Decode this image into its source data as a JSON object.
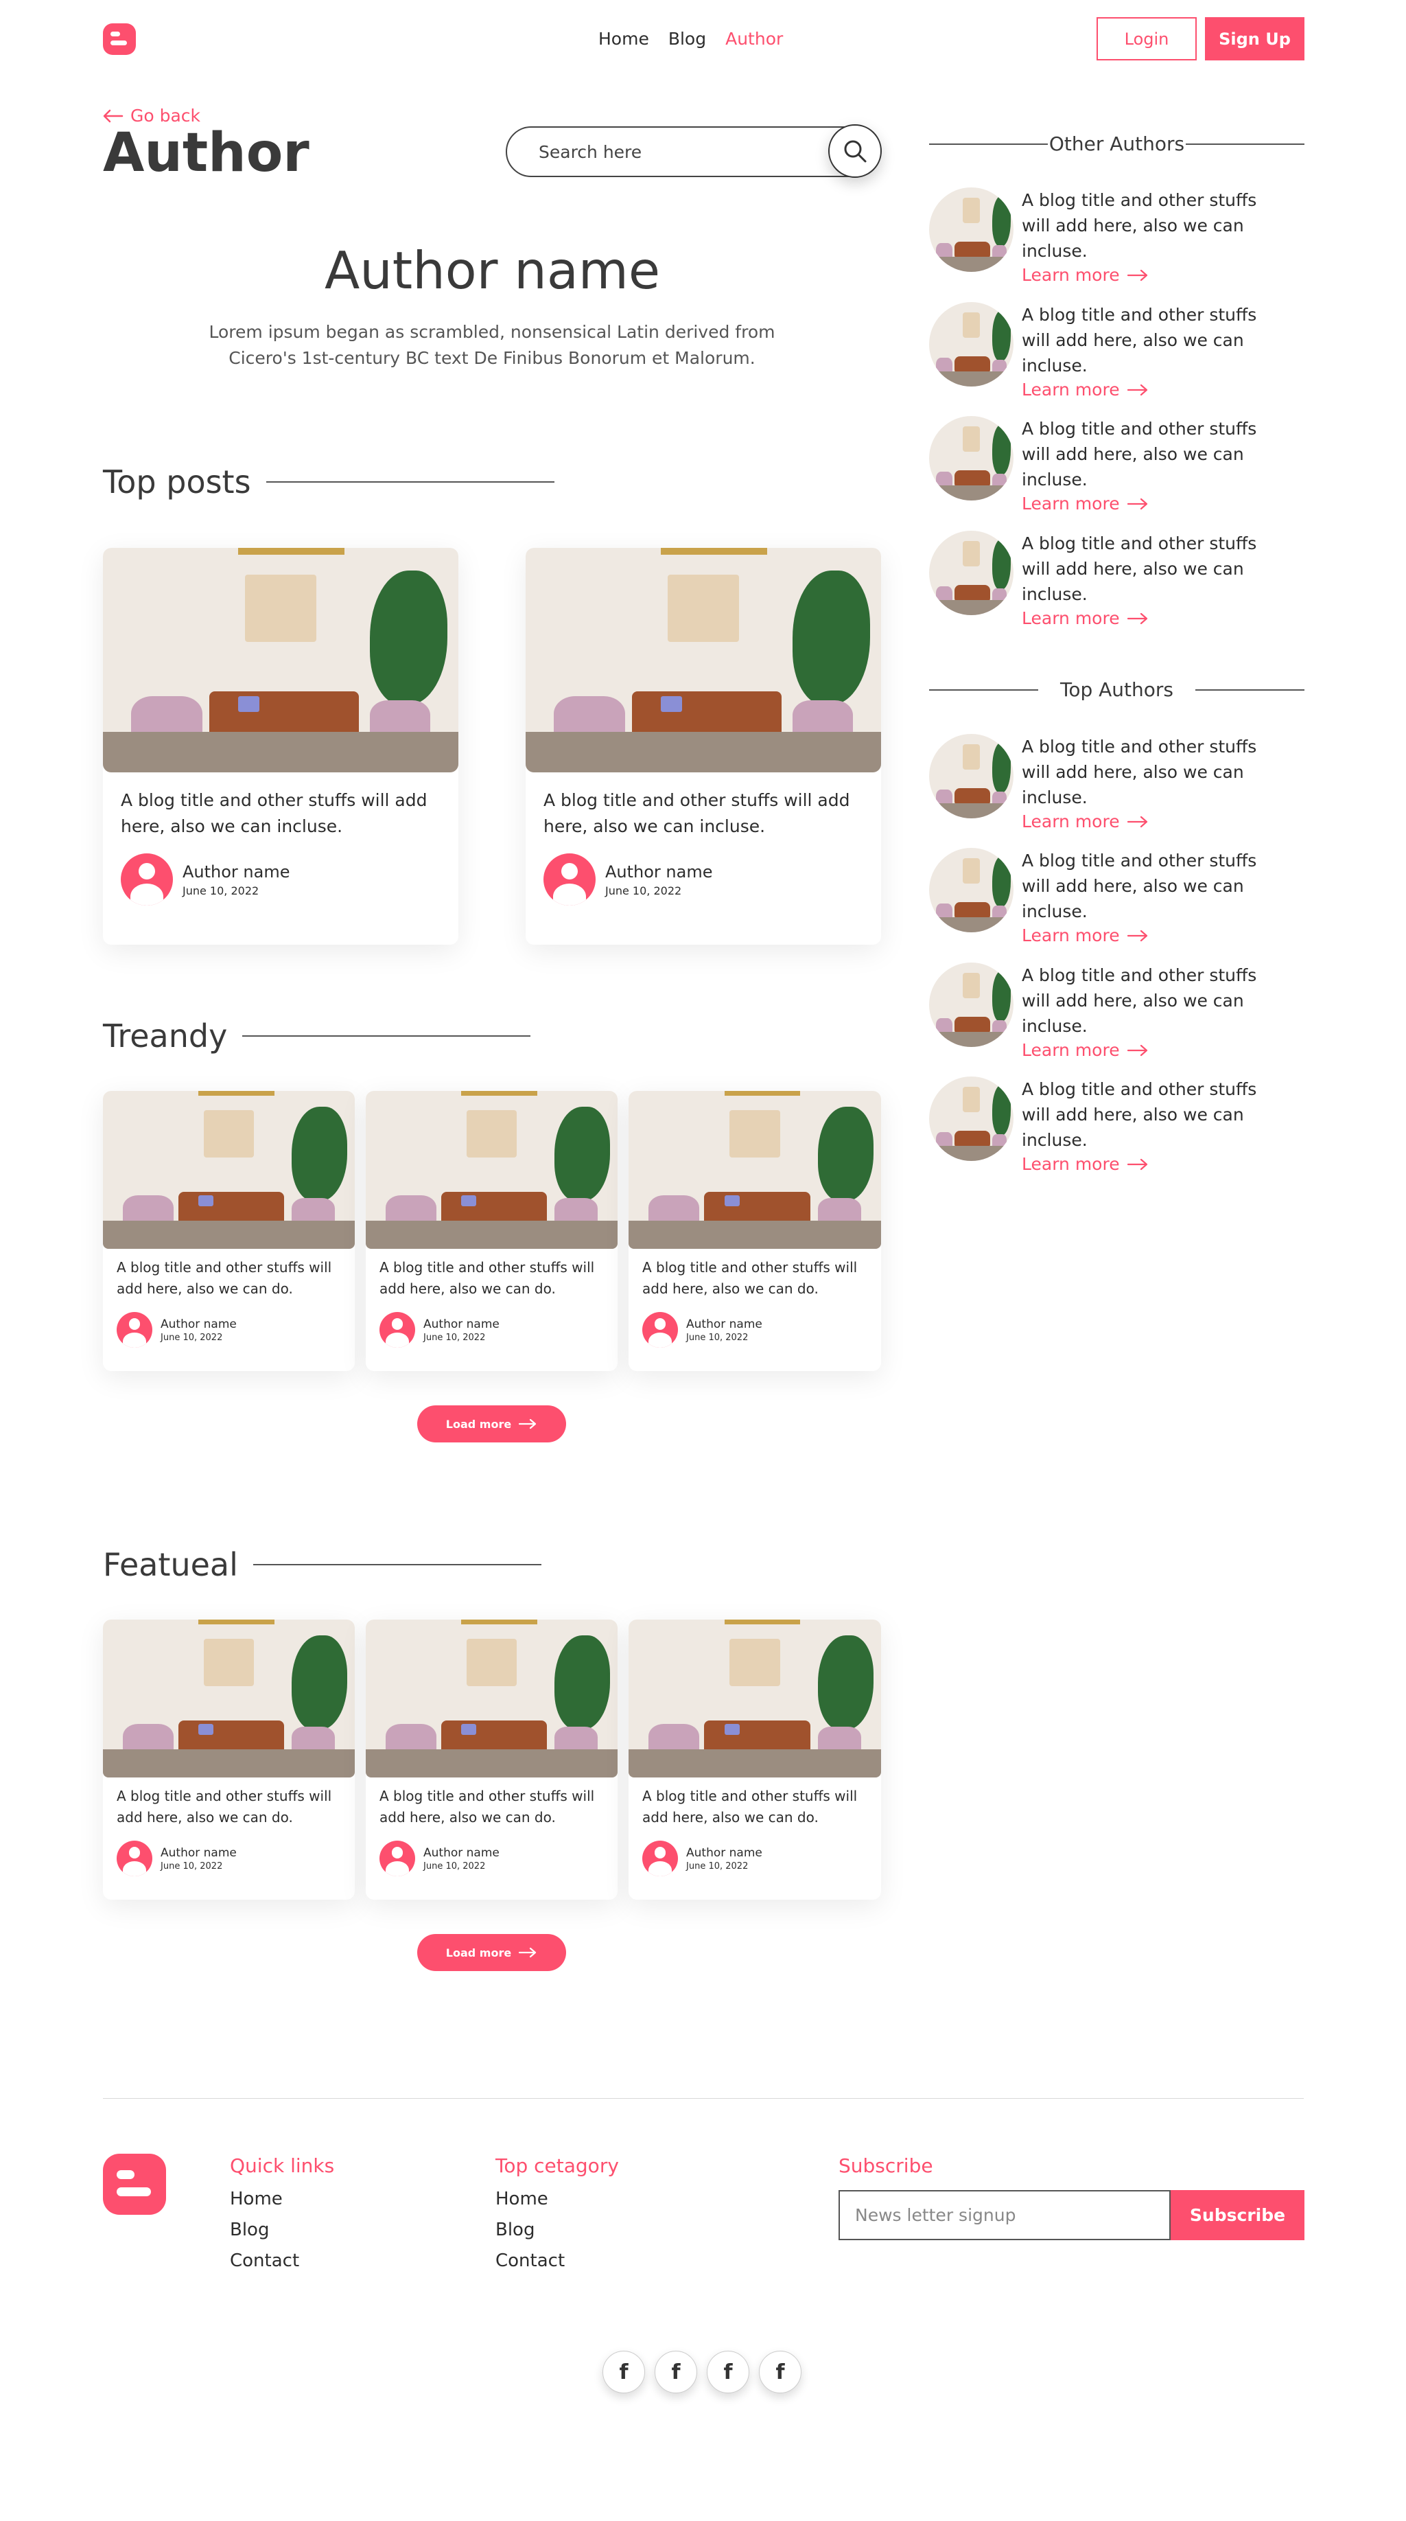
{
  "brand": {
    "accent": "#fd4f6e",
    "logo_icon": "blogger-b-icon"
  },
  "nav": {
    "items": [
      "Home",
      "Blog",
      "Author"
    ],
    "active": "Author"
  },
  "header": {
    "login_label": "Login",
    "signup_label": "Sign Up"
  },
  "page": {
    "go_back": "Go back",
    "title": "Author",
    "search_placeholder": "Search here",
    "author_name": "Author name",
    "author_bio": "Lorem ipsum began as scrambled, nonsensical Latin derived from Cicero's 1st-century BC text De Finibus Bonorum et Malorum."
  },
  "top_posts": {
    "title": "Top posts",
    "cards": [
      {
        "title": "A blog title and other stuffs will add here, also we can incluse.",
        "author": "Author name",
        "date": "June 10, 2022"
      },
      {
        "title": "A blog title and other stuffs will add here, also we can incluse.",
        "author": "Author name",
        "date": "June 10, 2022"
      }
    ]
  },
  "trendy": {
    "title": "Treandy",
    "load_more": "Load more",
    "cards": [
      {
        "title": "A blog title and other stuffs will add here, also we can do.",
        "author": "Author name",
        "date": "June 10, 2022"
      },
      {
        "title": "A blog title and other stuffs will add here, also we can do.",
        "author": "Author name",
        "date": "June 10, 2022"
      },
      {
        "title": "A blog title and other stuffs will add here, also we can do.",
        "author": "Author name",
        "date": "June 10, 2022"
      }
    ]
  },
  "featured": {
    "title": "Featueal",
    "load_more": "Load more",
    "cards": [
      {
        "title": "A blog title and other stuffs will add here, also we can do.",
        "author": "Author name",
        "date": "June 10, 2022"
      },
      {
        "title": "A blog title and other stuffs will add here, also we can do.",
        "author": "Author name",
        "date": "June 10, 2022"
      },
      {
        "title": "A blog title and other stuffs will add here, also we can do.",
        "author": "Author name",
        "date": "June 10, 2022"
      }
    ]
  },
  "sidebar": {
    "other_authors": {
      "title": "Other Authors",
      "items": [
        {
          "text": "A blog title and other stuffs will add here, also we can incluse.",
          "link": "Learn more"
        },
        {
          "text": "A blog title and other stuffs will add here, also we can incluse.",
          "link": "Learn more"
        },
        {
          "text": "A blog title and other stuffs will add here, also we can incluse.",
          "link": "Learn more"
        },
        {
          "text": "A blog title and other stuffs will add here, also we can incluse.",
          "link": "Learn more"
        }
      ]
    },
    "top_authors": {
      "title": "Top Authors",
      "items": [
        {
          "text": "A blog title and other stuffs will add here, also we can incluse.",
          "link": "Learn more"
        },
        {
          "text": "A blog title and other stuffs will add here, also we can incluse.",
          "link": "Learn more"
        },
        {
          "text": "A blog title and other stuffs will add here, also we can incluse.",
          "link": "Learn more"
        },
        {
          "text": "A blog title and other stuffs will add here, also we can incluse.",
          "link": "Learn more"
        }
      ]
    }
  },
  "footer": {
    "quick_links": {
      "title": "Quick links",
      "items": [
        "Home",
        "Blog",
        "Contact"
      ]
    },
    "top_category": {
      "title": "Top cetagory",
      "items": [
        "Home",
        "Blog",
        "Contact"
      ]
    },
    "subscribe": {
      "title": "Subscribe",
      "placeholder": "News letter signup",
      "button": "Subscribe"
    },
    "social_icons": [
      "facebook-icon",
      "facebook-icon",
      "facebook-icon",
      "facebook-icon"
    ],
    "social_glyph": "f"
  }
}
